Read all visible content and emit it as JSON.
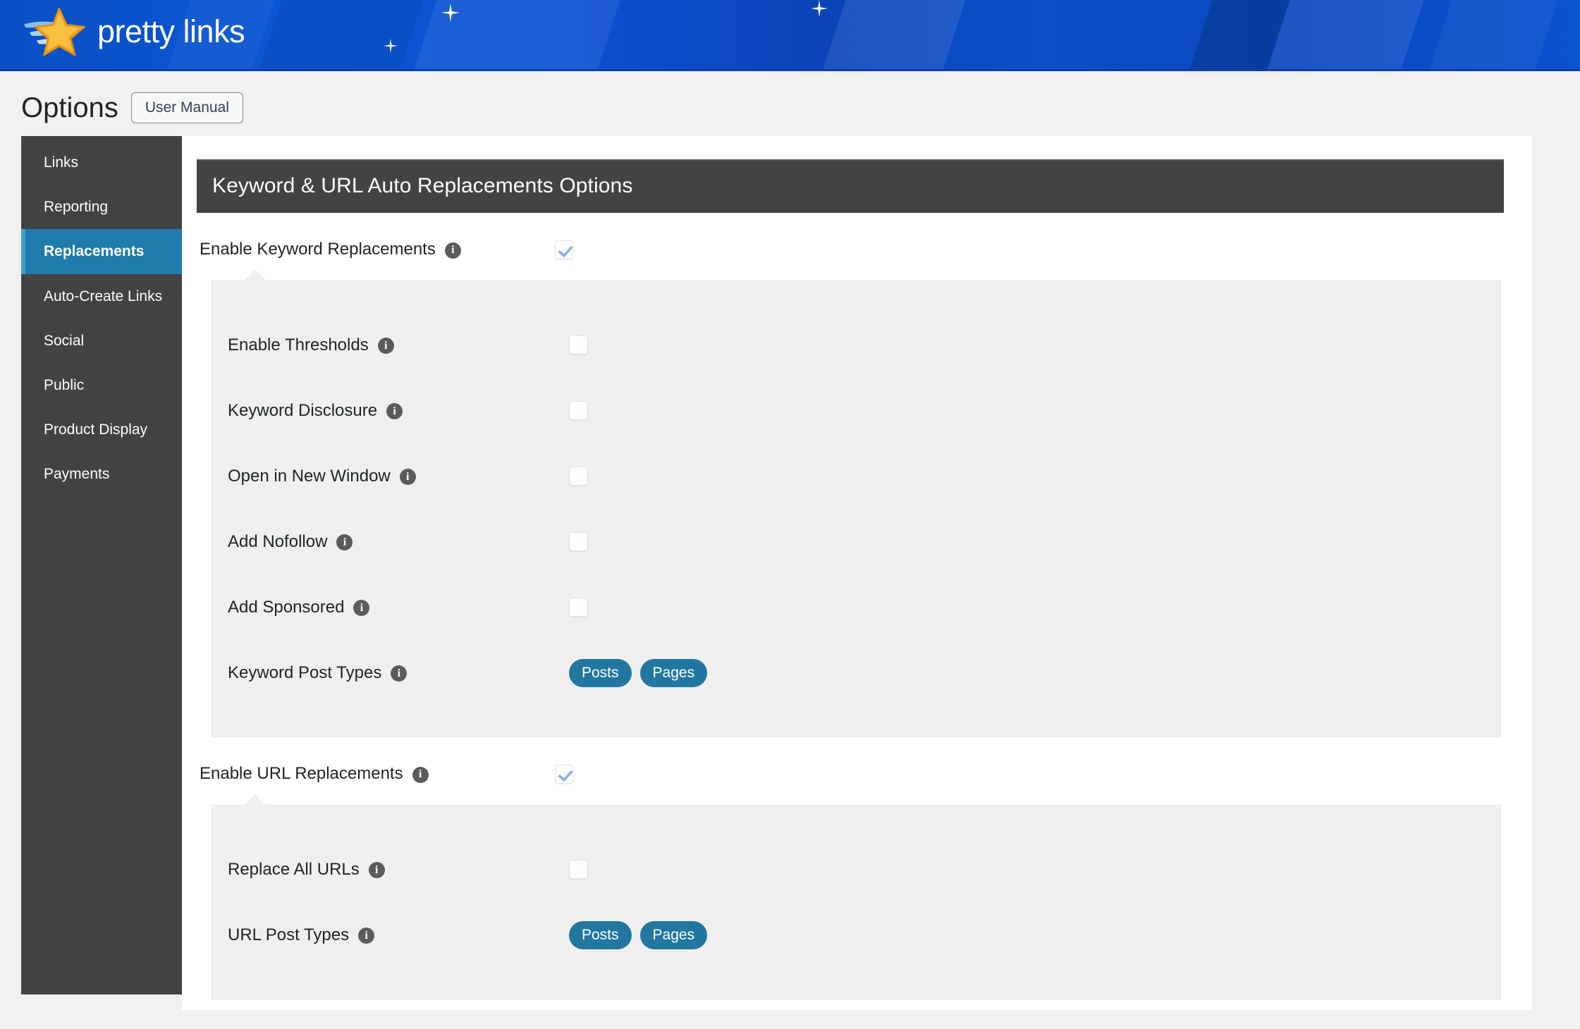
{
  "banner": {
    "logo_text": "pretty links",
    "logo_icon": "pretty-links-star-swoosh-logo",
    "sparkle_icon": "sparkle-icon"
  },
  "header": {
    "page_title": "Options",
    "user_manual_label": "User Manual"
  },
  "sidebar": {
    "items": [
      {
        "label": "Links",
        "active": false
      },
      {
        "label": "Reporting",
        "active": false
      },
      {
        "label": "Replacements",
        "active": true
      },
      {
        "label": "Auto-Create Links",
        "active": false
      },
      {
        "label": "Social",
        "active": false
      },
      {
        "label": "Public",
        "active": false
      },
      {
        "label": "Product Display",
        "active": false
      },
      {
        "label": "Payments",
        "active": false
      }
    ]
  },
  "main": {
    "section_title": "Keyword & URL Auto Replacements Options",
    "info_icon_glyph": "i",
    "keyword_section": {
      "toggle_label": "Enable Keyword Replacements",
      "toggle_checked": true,
      "rows": [
        {
          "label": "Enable Thresholds",
          "type": "checkbox",
          "checked": false
        },
        {
          "label": "Keyword Disclosure",
          "type": "checkbox",
          "checked": false
        },
        {
          "label": "Open in New Window",
          "type": "checkbox",
          "checked": false
        },
        {
          "label": "Add Nofollow",
          "type": "checkbox",
          "checked": false
        },
        {
          "label": "Add Sponsored",
          "type": "checkbox",
          "checked": false
        },
        {
          "label": "Keyword Post Types",
          "type": "pills",
          "pills": [
            "Posts",
            "Pages"
          ]
        }
      ]
    },
    "url_section": {
      "toggle_label": "Enable URL Replacements",
      "toggle_checked": true,
      "rows": [
        {
          "label": "Replace All URLs",
          "type": "checkbox",
          "checked": false
        },
        {
          "label": "URL Post Types",
          "type": "pills",
          "pills": [
            "Posts",
            "Pages"
          ]
        }
      ]
    }
  },
  "colors": {
    "banner_blue": "#0b4fc8",
    "sidebar_dark": "#424242",
    "sidebar_active": "#1f7bab",
    "section_head": "#434343",
    "pill_blue": "#2177a0",
    "check_blue": "#8cb4e0",
    "page_bg": "#f1f1f1"
  }
}
